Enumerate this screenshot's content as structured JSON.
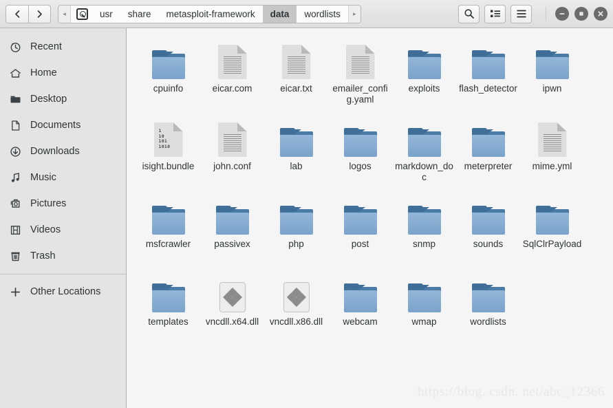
{
  "window": {
    "minimize_label": "−",
    "maximize_label": "□",
    "close_label": "×"
  },
  "header": {
    "back_label": "‹",
    "forward_label": "›",
    "path_left_arrow": "◂",
    "path_right_arrow": "▸",
    "breadcrumbs": [
      {
        "label": "usr",
        "current": false
      },
      {
        "label": "share",
        "current": false
      },
      {
        "label": "metasploit-framework",
        "current": false
      },
      {
        "label": "data",
        "current": true
      },
      {
        "label": "wordlists",
        "current": false
      }
    ],
    "search_label": "search-icon",
    "viewmode_label": "list-view-icon",
    "menu_label": "hamburger-menu-icon"
  },
  "sidebar": {
    "items": [
      {
        "label": "Recent",
        "icon": "clock-icon"
      },
      {
        "label": "Home",
        "icon": "home-icon"
      },
      {
        "label": "Desktop",
        "icon": "desktop-folder-icon"
      },
      {
        "label": "Documents",
        "icon": "document-icon"
      },
      {
        "label": "Downloads",
        "icon": "download-icon"
      },
      {
        "label": "Music",
        "icon": "music-note-icon"
      },
      {
        "label": "Pictures",
        "icon": "picture-icon"
      },
      {
        "label": "Videos",
        "icon": "film-icon"
      },
      {
        "label": "Trash",
        "icon": "trash-icon"
      }
    ],
    "other_locations": {
      "label": "Other Locations",
      "icon": "plus-icon"
    }
  },
  "files": [
    {
      "name": "cpuinfo",
      "type": "folder"
    },
    {
      "name": "eicar.com",
      "type": "document"
    },
    {
      "name": "eicar.txt",
      "type": "document"
    },
    {
      "name": "emailer_config.yaml",
      "type": "document"
    },
    {
      "name": "exploits",
      "type": "folder"
    },
    {
      "name": "flash_detector",
      "type": "folder"
    },
    {
      "name": "ipwn",
      "type": "folder"
    },
    {
      "name": "isight.bundle",
      "type": "binary-document"
    },
    {
      "name": "john.conf",
      "type": "document"
    },
    {
      "name": "lab",
      "type": "folder"
    },
    {
      "name": "logos",
      "type": "folder"
    },
    {
      "name": "markdown_doc",
      "type": "folder"
    },
    {
      "name": "meterpreter",
      "type": "folder"
    },
    {
      "name": "mime.yml",
      "type": "document"
    },
    {
      "name": "msfcrawler",
      "type": "folder"
    },
    {
      "name": "passivex",
      "type": "folder"
    },
    {
      "name": "php",
      "type": "folder"
    },
    {
      "name": "post",
      "type": "folder"
    },
    {
      "name": "snmp",
      "type": "folder"
    },
    {
      "name": "sounds",
      "type": "folder"
    },
    {
      "name": "SqlClrPayload",
      "type": "folder"
    },
    {
      "name": "templates",
      "type": "folder"
    },
    {
      "name": "vncdll.x64.dll",
      "type": "dll"
    },
    {
      "name": "vncdll.x86.dll",
      "type": "dll"
    },
    {
      "name": "webcam",
      "type": "folder"
    },
    {
      "name": "wmap",
      "type": "folder"
    },
    {
      "name": "wordlists",
      "type": "folder"
    }
  ],
  "binary_icon_bits": [
    "1",
    "10",
    "101",
    "1010"
  ],
  "watermark": "https://blog. csdn. net/abc_12366",
  "colors": {
    "folder_body": "#7aa3cb",
    "folder_tab": "#3f6e99",
    "sidebar_bg": "#e4e4e4",
    "main_bg": "#f5f5f5",
    "crumb_selected": "#c6c6c6"
  }
}
